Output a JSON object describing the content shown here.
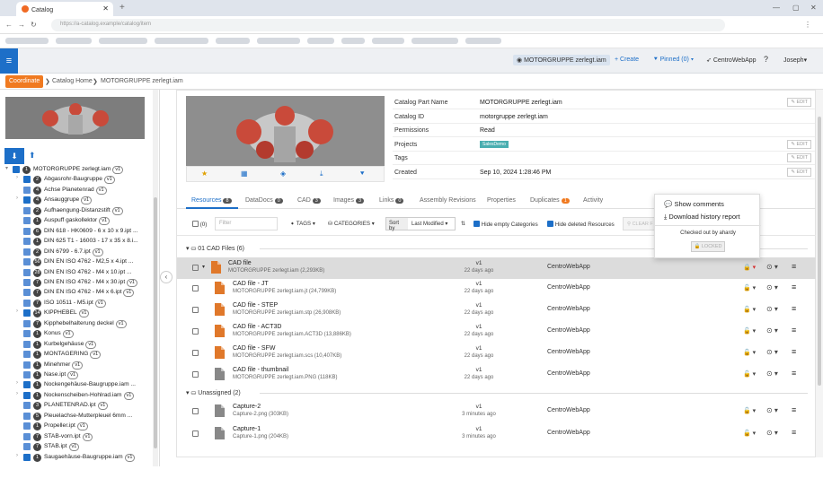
{
  "browser": {
    "tab_title": "Catalog",
    "url": "https://a-catalog.example/catalog/item",
    "new_tab": "+",
    "close": "✕"
  },
  "appbar": {
    "menu_icon": "≡",
    "item_name": "MOTORGRUPPE zerlegt.iam",
    "create": "+ Create",
    "pinned": "Pinned (0)",
    "app": "CentroWebApp",
    "user": "Joseph"
  },
  "breadcrumb": {
    "coordinate": "Coordinate",
    "home": "Catalog Home",
    "current": "MOTORGRUPPE zerlegt.iam"
  },
  "tree": [
    {
      "label": "MOTORGRUPPE zerlegt.iam",
      "count": "1",
      "v": "v1",
      "level": 0,
      "folder": true,
      "expanded": true
    },
    {
      "label": "Abgasrohr-Baugruppe",
      "count": "2",
      "v": "v1",
      "level": 1,
      "folder": true
    },
    {
      "label": "Achse Planetenrad",
      "count": "4",
      "v": "v1",
      "level": 1
    },
    {
      "label": "Ansauggrupe",
      "count": "4",
      "v": "v1",
      "level": 1,
      "folder": true
    },
    {
      "label": "Aufhaengung-Distanzstift",
      "count": "2",
      "v": "v1",
      "level": 1
    },
    {
      "label": "Auspuff gaskollektor",
      "count": "1",
      "v": "v1",
      "level": 1
    },
    {
      "label": "DIN 618 - HK0609 - 6 x 10 x 9.ipt ...",
      "count": "6",
      "v": "",
      "level": 1
    },
    {
      "label": "DIN 625 T1 - 16003 - 17 x 35 x 8.i...",
      "count": "1",
      "v": "",
      "level": 1
    },
    {
      "label": "DIN 6799 - 6.7.ipt",
      "count": "2",
      "v": "v1",
      "level": 1
    },
    {
      "label": "DIN EN ISO 4762 - M2,5 x 4.ipt ...",
      "count": "56",
      "v": "",
      "level": 1
    },
    {
      "label": "DIN EN ISO 4762 - M4 x 10.ipt ...",
      "count": "28",
      "v": "",
      "level": 1
    },
    {
      "label": "DIN EN ISO 4762 - M4 x 30.ipt",
      "count": "7",
      "v": "v1",
      "level": 1
    },
    {
      "label": "DIN EN ISO 4762 - M4 x 6.ipt",
      "count": "7",
      "v": "v1",
      "level": 1
    },
    {
      "label": "ISO 10511 - M5.ipt",
      "count": "7",
      "v": "v1",
      "level": 1
    },
    {
      "label": "KIPPHEBEL",
      "count": "14",
      "v": "v1",
      "level": 1,
      "folder": true
    },
    {
      "label": "Kipphebelhalterung deckel",
      "count": "7",
      "v": "v1",
      "level": 1
    },
    {
      "label": "Konus",
      "count": "1",
      "v": "v1",
      "level": 1
    },
    {
      "label": "Kurbelgehäuse",
      "count": "1",
      "v": "v1",
      "level": 1
    },
    {
      "label": "MONTAGERING",
      "count": "1",
      "v": "v1",
      "level": 1
    },
    {
      "label": "Minehmer",
      "count": "1",
      "v": "v1",
      "level": 1
    },
    {
      "label": "Nase.ipt",
      "count": "1",
      "v": "v1",
      "level": 1
    },
    {
      "label": "Nockengehäuse-Baugruppe.iam ...",
      "count": "1",
      "v": "",
      "level": 1,
      "folder": true
    },
    {
      "label": "Nockenscheiben-Hohlrad.iam",
      "count": "1",
      "v": "v1",
      "level": 1,
      "folder": true
    },
    {
      "label": "PLANETENRAD.ipt",
      "count": "3",
      "v": "v1",
      "level": 1
    },
    {
      "label": "Pleuelachse-Mutterpleuel 6mm ...",
      "count": "5",
      "v": "",
      "level": 1
    },
    {
      "label": "Propeller.ipt",
      "count": "1",
      "v": "v1",
      "level": 1
    },
    {
      "label": "STAB-vorn.ipt",
      "count": "7",
      "v": "v1",
      "level": 1
    },
    {
      "label": "STAB.ipt",
      "count": "7",
      "v": "v1",
      "level": 1
    },
    {
      "label": "Saugaehäuse-Baugruppe.iam",
      "count": "1",
      "v": "v1",
      "level": 1,
      "folder": true
    }
  ],
  "props": [
    {
      "k": "Catalog Part Name",
      "v": "MOTORGRUPPE zerlegt.iam",
      "edit": "EDIT"
    },
    {
      "k": "Catalog ID",
      "v": "motorgruppe zerlegt.iam",
      "edit": ""
    },
    {
      "k": "Permissions",
      "v": "Read",
      "edit": ""
    },
    {
      "k": "Projects",
      "v": "",
      "tag": "SalesDemo",
      "edit": "EDIT"
    },
    {
      "k": "Tags",
      "v": "",
      "edit": "EDIT"
    },
    {
      "k": "Created",
      "v": "Sep 10, 2024 1:28:46 PM",
      "edit": "EDIT"
    }
  ],
  "tabs": [
    {
      "label": "Resources",
      "count": "8"
    },
    {
      "label": "DataDocs",
      "count": "0"
    },
    {
      "label": "CAD",
      "count": "3"
    },
    {
      "label": "Images",
      "count": "3"
    },
    {
      "label": "Links",
      "count": "0"
    },
    {
      "label": "Assembly Revisions",
      "count": ""
    },
    {
      "label": "Properties",
      "count": ""
    },
    {
      "label": "Duplicates",
      "count": "1"
    },
    {
      "label": "Activity",
      "count": ""
    }
  ],
  "toolbar": {
    "sel_count": "(0)",
    "filter_placeholder": "Filter",
    "tags": "TAGS",
    "categories": "CATEGORIES",
    "sort_by": "Sort by",
    "sort_value": "Last Modified",
    "hide_empty": "Hide empty Categories",
    "hide_deleted": "Hide deleted Resources",
    "clear": "CLEAR F"
  },
  "groups": {
    "cad": "01 CAD Files (6)",
    "unassigned": "Unassigned (2)"
  },
  "rows": [
    {
      "title": "CAD file",
      "file": "MOTORGRUPPE zerlegt.iam (2,293KB)",
      "v": "v1",
      "ago": "22 days ago",
      "app": "CentroWebApp",
      "color": "#e0782a",
      "locked": true
    },
    {
      "title": "CAD file - JT",
      "file": "MOTORGRUPPE zerlegt.iam.jt (24,799KB)",
      "v": "v1",
      "ago": "22 days ago",
      "app": "CentroWebApp",
      "color": "#e0782a"
    },
    {
      "title": "CAD file - STEP",
      "file": "MOTORGRUPPE zerlegt.iam.stp (26,908KB)",
      "v": "v1",
      "ago": "22 days ago",
      "app": "CentroWebApp",
      "color": "#e0782a"
    },
    {
      "title": "CAD file - ACT3D",
      "file": "MOTORGRUPPE zerlegt.iam.ACT3D (13,886KB)",
      "v": "v1",
      "ago": "22 days ago",
      "app": "CentroWebApp",
      "color": "#e0782a"
    },
    {
      "title": "CAD file - SFW",
      "file": "MOTORGRUPPE zerlegt.iam.scs (10,407KB)",
      "v": "v1",
      "ago": "22 days ago",
      "app": "CentroWebApp",
      "color": "#e0782a"
    },
    {
      "title": "CAD file - thumbnail",
      "file": "MOTORGRUPPE zerlegt.iam.PNG (118KB)",
      "v": "v1",
      "ago": "22 days ago",
      "app": "CentroWebApp",
      "color": "#888"
    },
    {
      "title": "Capture-2",
      "file": "Capture-2.png (303KB)",
      "v": "v1",
      "ago": "3 minutes ago",
      "app": "CentroWebApp",
      "color": "#888"
    },
    {
      "title": "Capture-1",
      "file": "Capture-1.png (204KB)",
      "v": "v1",
      "ago": "3 minutes ago",
      "app": "CentroWebApp",
      "color": "#888"
    }
  ],
  "popup": {
    "show_comments": "Show comments",
    "download_history": "Download history report",
    "checked_out": "Checked out by ahardy",
    "locked": "LOCKED"
  },
  "colors": {
    "accent": "#1d6fc8",
    "coordinate": "#f07a20"
  }
}
